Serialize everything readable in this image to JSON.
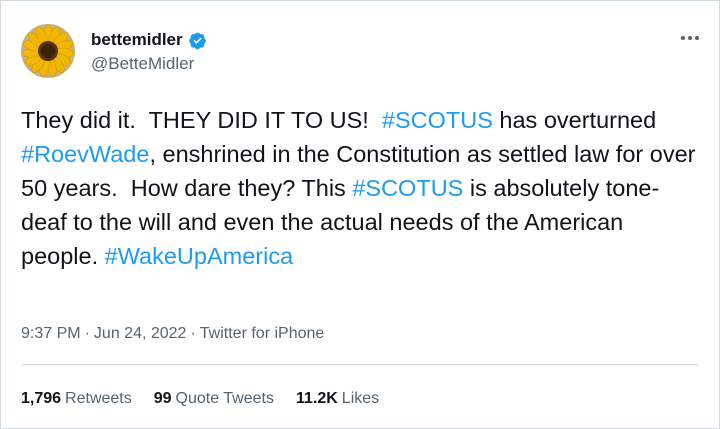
{
  "author": {
    "display_name": "bettemidler",
    "handle": "@BetteMidler",
    "avatar_icon": "sunflower-avatar",
    "verified_icon": "verified-badge-icon"
  },
  "more_icon": "more-options-icon",
  "tweet": {
    "segments": [
      {
        "text": "They did it.  THEY DID IT TO US!  ",
        "tag": false
      },
      {
        "text": "#SCOTUS",
        "tag": true
      },
      {
        "text": " has overturned ",
        "tag": false
      },
      {
        "text": "#RoevWade",
        "tag": true
      },
      {
        "text": ", enshrined in the Constitution as settled law for over 50 years.  How dare they? This ",
        "tag": false
      },
      {
        "text": "#SCOTUS",
        "tag": true
      },
      {
        "text": " is absolutely tone-deaf to the will and even the actual needs of the American people. ",
        "tag": false
      },
      {
        "text": "#WakeUpAmerica",
        "tag": true
      }
    ]
  },
  "meta": {
    "time": "9:37 PM",
    "date": "Jun 24, 2022",
    "source": "Twitter for iPhone",
    "separator": "·"
  },
  "stats": {
    "retweets_count": "1,796",
    "retweets_label": "Retweets",
    "quotes_count": "99",
    "quotes_label": "Quote Tweets",
    "likes_count": "11.2K",
    "likes_label": "Likes"
  },
  "colors": {
    "link": "#1d9bf0",
    "text": "#0f1419",
    "secondary": "#536471",
    "verified": "#1d9bf0"
  }
}
